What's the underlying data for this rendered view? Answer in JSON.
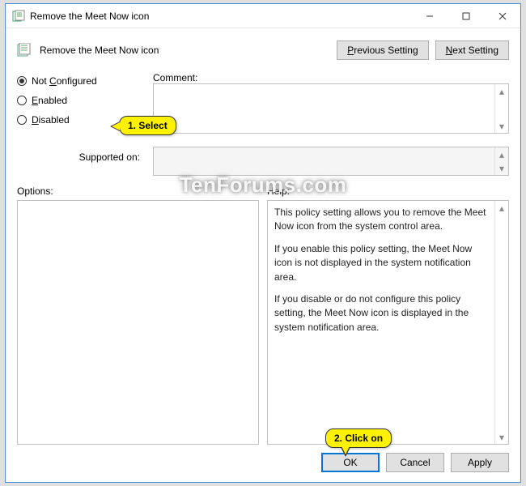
{
  "window": {
    "title": "Remove the Meet Now icon"
  },
  "policy": {
    "name": "Remove the Meet Now icon"
  },
  "nav": {
    "previous": "Previous Setting",
    "next": "Next Setting"
  },
  "radios": {
    "notconfigured": "Not Configured",
    "enabled": "Enabled",
    "disabled": "Disabled",
    "selected": "notconfigured"
  },
  "labels": {
    "comment": "Comment:",
    "supported": "Supported on:",
    "options": "Options:",
    "help": "Help:"
  },
  "comment": "",
  "supported": "",
  "options": "",
  "help": {
    "p1": "This policy setting allows you to remove the Meet Now icon from the system control area.",
    "p2": "If you enable this policy setting, the Meet Now icon is not displayed in the system notification area.",
    "p3": "If you disable or do not configure this policy setting, the Meet Now icon is displayed in the system notification area."
  },
  "buttons": {
    "ok": "OK",
    "cancel": "Cancel",
    "apply": "Apply"
  },
  "callouts": {
    "select": "1. Select",
    "click": "2. Click on"
  },
  "watermark": "TenForums.com"
}
